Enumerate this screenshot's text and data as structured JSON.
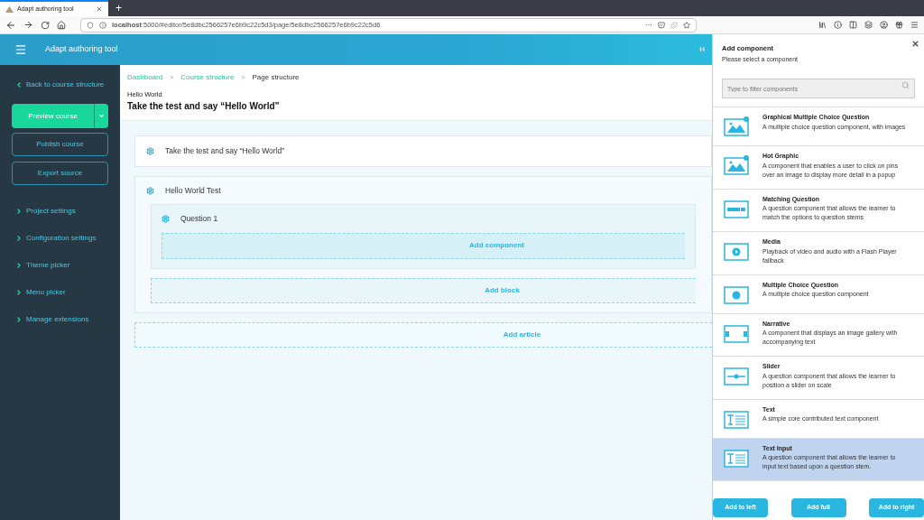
{
  "browser": {
    "tab_title": "Adapt authoring tool",
    "new_tab": "+",
    "url": "**localhost**:5000/#editor/5e8dbc2566257e6b9c22c5d3/page/5e8dbc2566257e6b9c22c5d6",
    "menu_dots": "···"
  },
  "header": {
    "title": "Adapt authoring tool",
    "user": "H"
  },
  "sidebar": {
    "back": "Back to course structure",
    "preview": "Preview course",
    "publish": "Publish course",
    "export": "Export source",
    "items": [
      "Project settings",
      "Configuration settings",
      "Theme picker",
      "Menu picker",
      "Manage extensions"
    ]
  },
  "breadcrumbs": [
    {
      "label": "Dashboard",
      "link": true
    },
    {
      "label": "Course structure",
      "link": true
    },
    {
      "label": "Page structure",
      "link": false
    }
  ],
  "breadcrumb_separator": ">",
  "page": {
    "subtitle": "Hello World",
    "title": "Take the test and say “Hello World”"
  },
  "article": {
    "title": "Take the test and say “Hello World”"
  },
  "block": {
    "title": "Hello World Test",
    "component": {
      "title": "Question 1",
      "add_label": "Add component"
    },
    "add_label": "Add block"
  },
  "add_article": "Add article",
  "panel": {
    "title": "Add component",
    "subtitle": "Please select a component",
    "search": {
      "placeholder": "Type to filter components"
    },
    "components": [
      {
        "kind": "graphic-question",
        "name": "Graphical Multiple Choice Question",
        "description": "A multiple choice question component, with images",
        "selected": false
      },
      {
        "kind": "hotgraphic",
        "name": "Hot Graphic",
        "description": "A component that enables a user to click on pins over an image to display more detail in a popup",
        "selected": false
      },
      {
        "kind": "matching",
        "name": "Matching Question",
        "description": "A question component that allows the learner to match the options to question stems",
        "selected": false
      },
      {
        "kind": "media",
        "name": "Media",
        "description": "Playback of video and audio with a Flash Player fallback",
        "selected": false
      },
      {
        "kind": "question",
        "name": "Multiple Choice Question",
        "description": "A multiple choice question component",
        "selected": false
      },
      {
        "kind": "narrative",
        "name": "Narrative",
        "description": "A component that displays an image gallery with accompanying text",
        "selected": false
      },
      {
        "kind": "slider",
        "name": "Slider",
        "description": "A question component that allows the learner to position a slider on scale",
        "selected": false
      },
      {
        "kind": "text",
        "name": "Text",
        "description": "A simple core contributed text component",
        "selected": false
      },
      {
        "kind": "text",
        "name": "Text Input",
        "description": "A question component that allows the learner to input text based upon a question stem.",
        "selected": true
      }
    ],
    "buttons": [
      "Add to left",
      "Add full",
      "Add to right"
    ]
  }
}
